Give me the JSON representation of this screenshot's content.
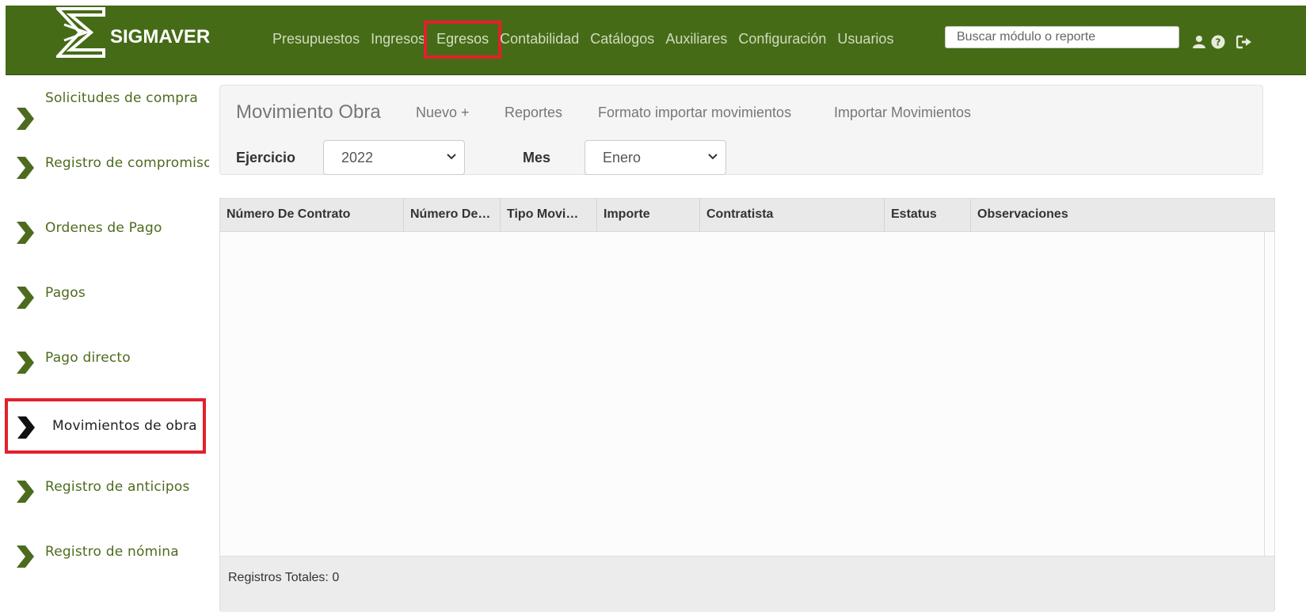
{
  "brand": {
    "name": "SIGMAVER"
  },
  "nav": {
    "items": [
      {
        "label": "Presupuestos"
      },
      {
        "label": "Ingresos"
      },
      {
        "label": "Egresos",
        "highlighted": true
      },
      {
        "label": "Contabilidad"
      },
      {
        "label": "Catálogos"
      },
      {
        "label": "Auxiliares"
      },
      {
        "label": "Configuración"
      },
      {
        "label": "Usuarios"
      }
    ],
    "search_placeholder": "Buscar módulo o reporte",
    "icons": [
      "user-icon",
      "help-icon",
      "logout-icon"
    ]
  },
  "sidebar": {
    "items": [
      {
        "label": "Solicitudes de compra"
      },
      {
        "label": "Registro de compromiso"
      },
      {
        "label": "Ordenes de Pago"
      },
      {
        "label": "Pagos"
      },
      {
        "label": "Pago directo"
      },
      {
        "label": "Movimientos de obra",
        "active": true
      },
      {
        "label": "Registro de anticipos"
      },
      {
        "label": "Registro de nómina"
      }
    ]
  },
  "panel": {
    "title": "Movimiento Obra",
    "new_label": "Nuevo +",
    "reports_label": "Reportes",
    "import_format_label": "Formato importar movimientos",
    "import_label": "Importar Movimientos",
    "ejercicio_label": "Ejercicio",
    "ejercicio_value": "2022",
    "mes_label": "Mes",
    "mes_value": "Enero"
  },
  "grid": {
    "columns": [
      "Número De Contrato",
      "Número De…",
      "Tipo Movi…",
      "Importe",
      "Contratista",
      "Estatus",
      "Observaciones"
    ],
    "footer": "Registros Totales: 0"
  },
  "colors": {
    "navbar": "#456b17",
    "sidebar_chevron": "#4d6b1e",
    "highlight": "#e3202b"
  }
}
